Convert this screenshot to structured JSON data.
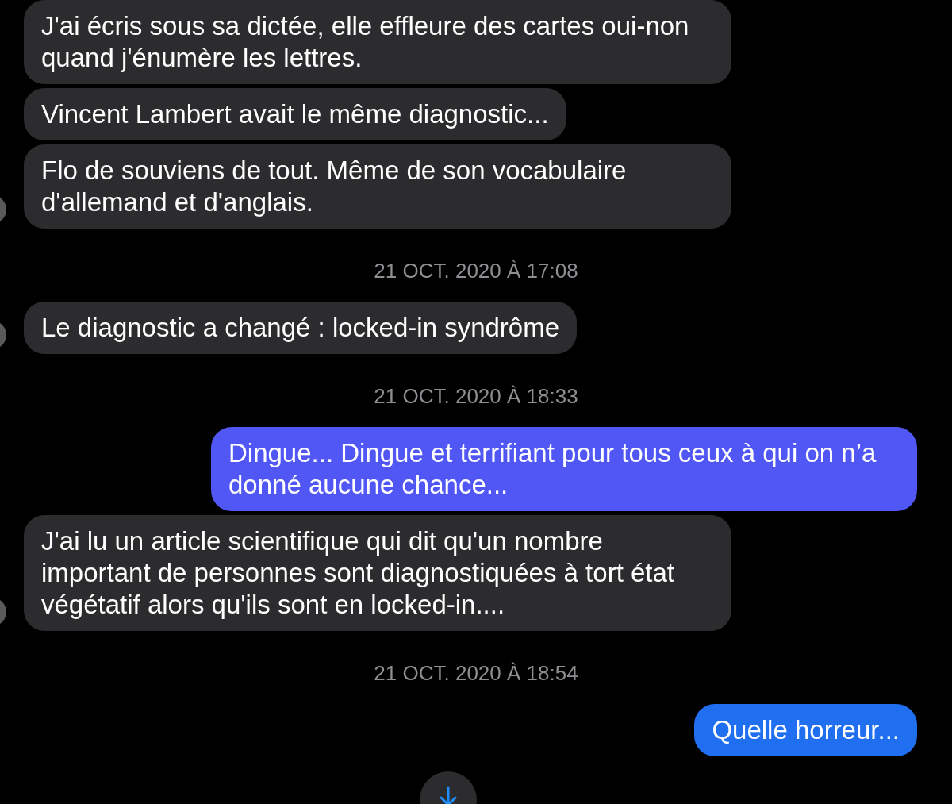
{
  "messages": [
    {
      "kind": "received",
      "text": "J'ai écris sous sa dictée, elle effleure des cartes oui-non quand j'énumère les lettres.",
      "avatar": false
    },
    {
      "kind": "received",
      "text": "Vincent Lambert avait le même diagnostic...",
      "avatar": false
    },
    {
      "kind": "received",
      "text": "Flo de souviens de tout. Même de son vocabulaire d'allemand et d'anglais.",
      "avatar": true
    },
    {
      "kind": "timestamp",
      "text": "21 OCT. 2020 À 17:08"
    },
    {
      "kind": "received",
      "text": "Le diagnostic a changé : locked-in syndrôme",
      "avatar": true
    },
    {
      "kind": "timestamp",
      "text": "21 OCT. 2020 À 18:33"
    },
    {
      "kind": "sent",
      "text": "Dingue... Dingue et terrifiant pour tous ceux à qui on n’a donné aucune chance...",
      "color": "#5157f5"
    },
    {
      "kind": "received",
      "text": "J'ai lu un article scientifique qui dit qu'un nombre important de personnes sont diagnostiquées à tort état végétatif alors qu'ils sont en locked-in....",
      "avatar": true
    },
    {
      "kind": "timestamp",
      "text": "21 OCT. 2020 À 18:54"
    },
    {
      "kind": "sent",
      "text": "Quelle horreur...",
      "color": "#1f6ff0"
    }
  ]
}
